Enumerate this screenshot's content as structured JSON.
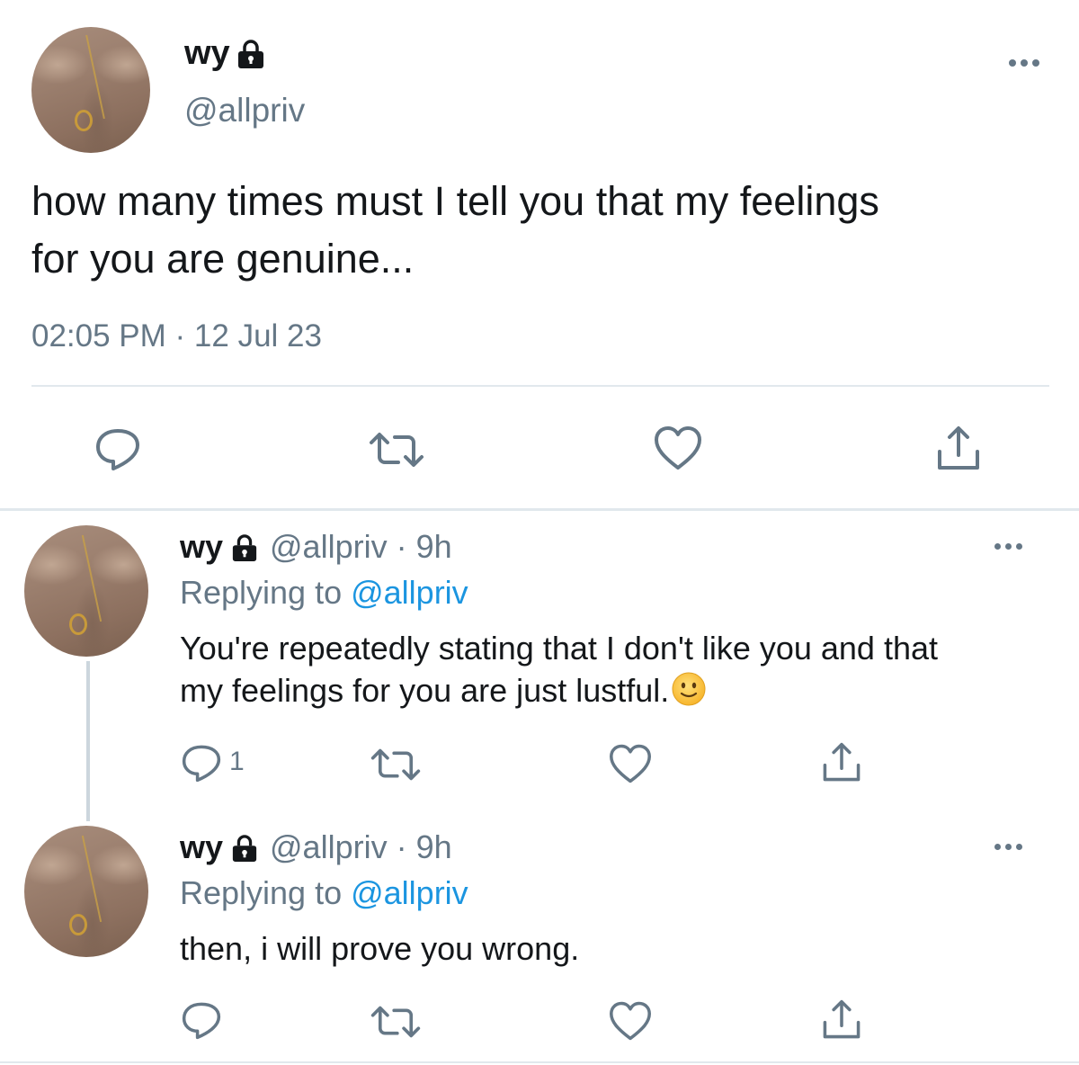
{
  "main_tweet": {
    "display_name": "wy",
    "handle": "@allpriv",
    "text_line1": "how many times must I tell you that my feelings",
    "text_line2": "for you are genuine...",
    "timestamp": "02:05 PM · 12 Jul 23"
  },
  "replies": [
    {
      "display_name": "wy",
      "handle_time": "@allpriv · 9h",
      "replying_prefix": "Replying to ",
      "replying_handle": "@allpriv",
      "text_line1": "You're repeatedly stating that I don't like you and that",
      "text_line2": "my feelings for you are just lustful.",
      "emoji": "slightly-smiling-face",
      "reply_count": "1"
    },
    {
      "display_name": "wy",
      "handle_time": "@allpriv · 9h",
      "replying_prefix": "Replying to ",
      "replying_handle": "@allpriv",
      "text_line1": "then, i will prove you wrong.",
      "reply_count": ""
    }
  ],
  "colors": {
    "text": "#14171a",
    "secondary": "#657786",
    "link": "#1b95e0",
    "divider": "#e1e8ed"
  },
  "icons": [
    "lock-icon",
    "more-icon",
    "reply-icon",
    "retweet-icon",
    "like-icon",
    "share-icon"
  ]
}
